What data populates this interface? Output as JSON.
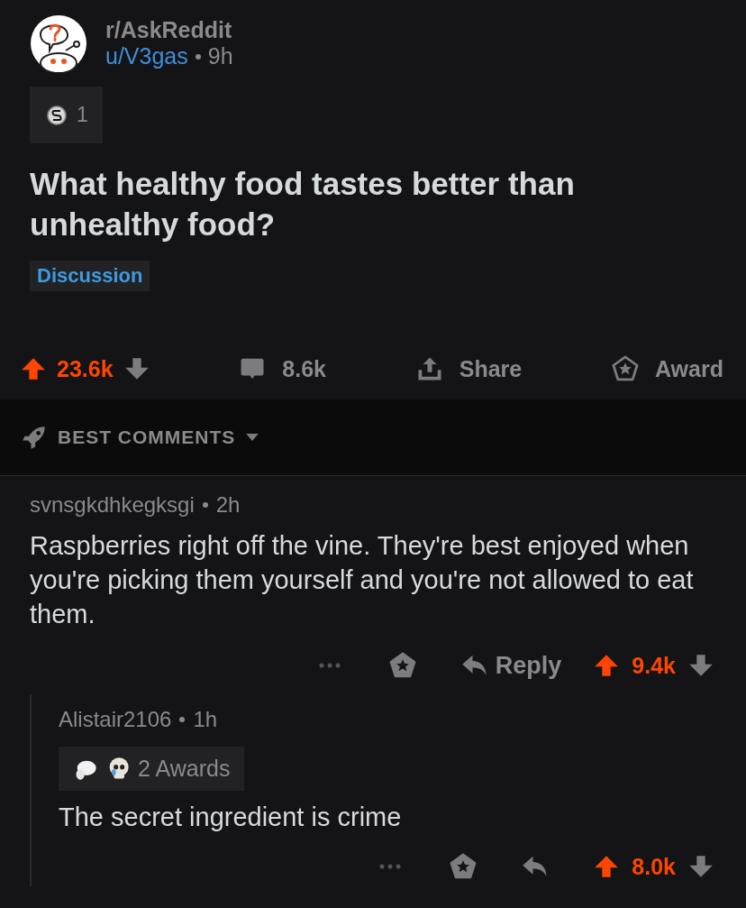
{
  "post": {
    "subreddit": "r/AskReddit",
    "author": "u/V3gas",
    "age": "9h",
    "coin_count": "1",
    "title": "What healthy food tastes better than unhealthy food?",
    "flair": "Discussion",
    "score": "23.6k",
    "upvoted": true,
    "comments_count": "8.6k",
    "share_label": "Share",
    "award_label": "Award"
  },
  "sort": {
    "label": "BEST COMMENTS"
  },
  "comments": [
    {
      "author": "svnsgkdhkegksgi",
      "age": "2h",
      "body": "Raspberries right off the vine. They're best enjoyed when you're picking them yourself and you're not allowed to eat them.",
      "reply_label": "Reply",
      "score": "9.4k",
      "upvoted": true,
      "children": [
        {
          "author": "Alistair2106",
          "age": "1h",
          "awards_label": "2 Awards",
          "body": "The secret ingredient is crime",
          "score": "8.0k",
          "upvoted": true
        }
      ]
    }
  ]
}
